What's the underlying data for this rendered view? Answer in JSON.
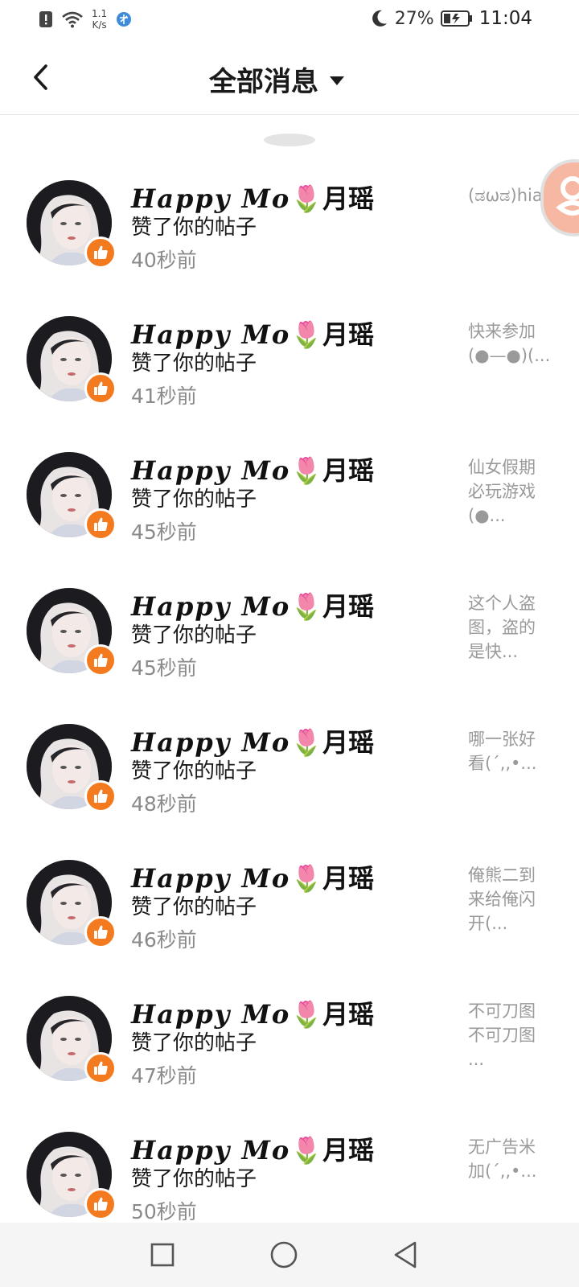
{
  "status_bar": {
    "net_speed_value": "1.1",
    "net_speed_unit": "K/s",
    "battery": "27%",
    "time": "11:04",
    "icons": [
      "alert-icon",
      "wifi-icon",
      "network-app-icon",
      "moon-icon",
      "battery-icon"
    ]
  },
  "header": {
    "title": "全部消息",
    "back_icon": "back-arrow-icon",
    "dropdown_icon": "caret-down-icon"
  },
  "messages": [
    {
      "name_script": "Happy Mo",
      "name_emoji": "🌷",
      "name_cn": "月瑶",
      "action": "赞了你的帖子",
      "time": "40秒前",
      "preview": "(ಡωಡ)hiahi..."
    },
    {
      "name_script": "Happy Mo",
      "name_emoji": "🌷",
      "name_cn": "月瑶",
      "action": "赞了你的帖子",
      "time": "41秒前",
      "preview": "快来参加\n(●—●)(..."
    },
    {
      "name_script": "Happy Mo",
      "name_emoji": "🌷",
      "name_cn": "月瑶",
      "action": "赞了你的帖子",
      "time": "45秒前",
      "preview": "仙女假期\n必玩游戏\n(●..."
    },
    {
      "name_script": "Happy Mo",
      "name_emoji": "🌷",
      "name_cn": "月瑶",
      "action": "赞了你的帖子",
      "time": "45秒前",
      "preview": "这个人盗\n图，盗的\n是快..."
    },
    {
      "name_script": "Happy Mo",
      "name_emoji": "🌷",
      "name_cn": "月瑶",
      "action": "赞了你的帖子",
      "time": "48秒前",
      "preview": "哪一张好\n看(´,,•..."
    },
    {
      "name_script": "Happy Mo",
      "name_emoji": "🌷",
      "name_cn": "月瑶",
      "action": "赞了你的帖子",
      "time": "46秒前",
      "preview": "俺熊二到\n来给俺闪\n开(..."
    },
    {
      "name_script": "Happy Mo",
      "name_emoji": "🌷",
      "name_cn": "月瑶",
      "action": "赞了你的帖子",
      "time": "47秒前",
      "preview": "不可刀图\n不可刀图\n..."
    },
    {
      "name_script": "Happy Mo",
      "name_emoji": "🌷",
      "name_cn": "月瑶",
      "action": "赞了你的帖子",
      "time": "50秒前",
      "preview": "无广告米\n加(´,,•..."
    }
  ],
  "colors": {
    "like_badge": "#f47a20",
    "time_text": "#8a8a8a",
    "preview_text": "#9a9a9a",
    "float_button": "#f6b8a2"
  },
  "nav_bar": {
    "icons": [
      "recents-square-icon",
      "home-circle-icon",
      "back-triangle-icon"
    ]
  }
}
